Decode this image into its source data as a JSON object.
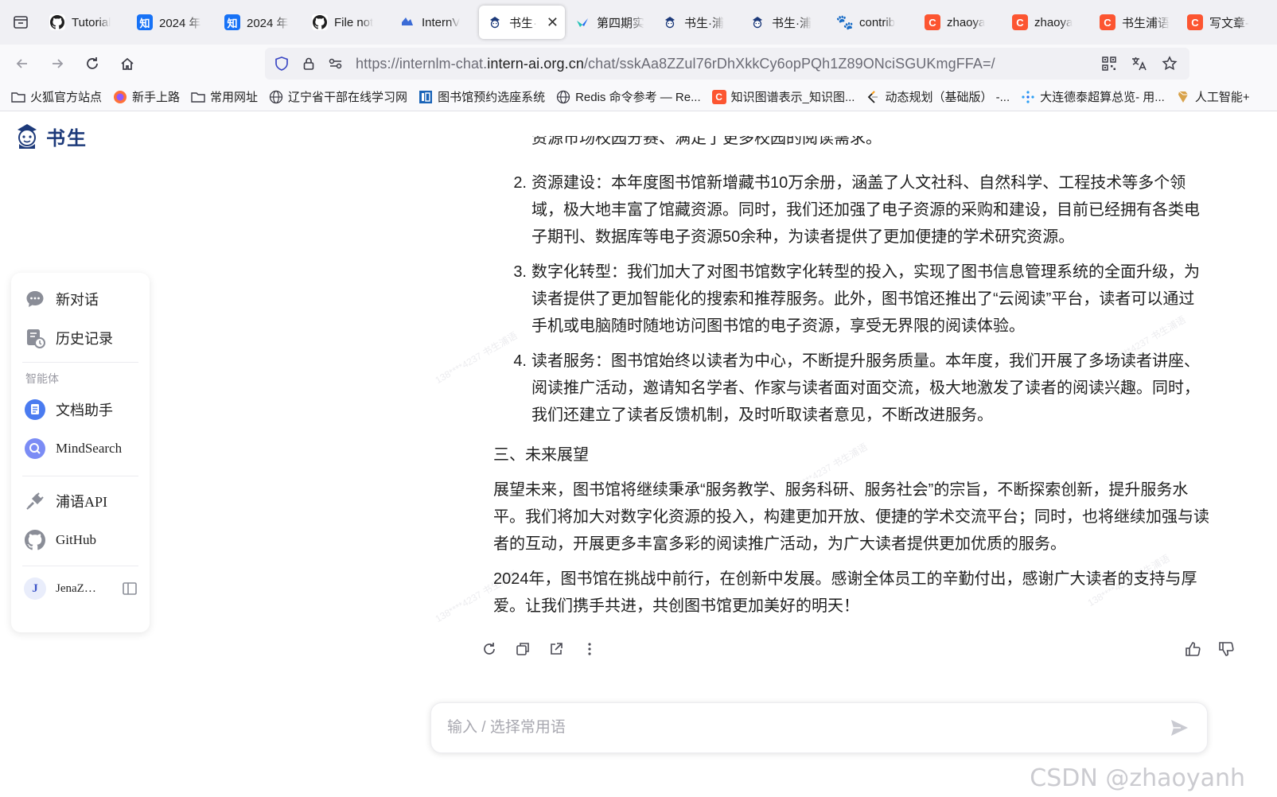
{
  "browser": {
    "tabs": [
      {
        "label": "Tutorial",
        "icon": "github-icon"
      },
      {
        "label": "2024 年",
        "icon": "zhihu-icon"
      },
      {
        "label": "2024 年",
        "icon": "zhihu-icon"
      },
      {
        "label": "File not",
        "icon": "github-icon"
      },
      {
        "label": "InternV",
        "icon": "internvl-icon"
      },
      {
        "label": "书生·",
        "icon": "shusheng-icon",
        "active": true
      },
      {
        "label": "第四期实",
        "icon": "feishu-icon"
      },
      {
        "label": "书生·浦",
        "icon": "shusheng-icon"
      },
      {
        "label": "书生·浦",
        "icon": "shusheng-icon"
      },
      {
        "label": "contrib",
        "icon": "paw-icon"
      },
      {
        "label": "zhaoya",
        "icon": "csdn-icon"
      },
      {
        "label": "zhaoya",
        "icon": "csdn-icon"
      },
      {
        "label": "书生浦语",
        "icon": "csdn-icon"
      },
      {
        "label": "写文章-",
        "icon": "csdn-icon"
      }
    ],
    "close_glyph": "✕",
    "url_prefix": "https://internlm-chat.",
    "url_domain": "intern-ai.org.cn",
    "url_suffix": "/chat/sskAa8ZZul76rDhXkkCy6opPQh1Z89ONciSGUKmgFFA=/",
    "bookmarks": [
      {
        "label": "火狐官方站点",
        "icon": "folder-icon"
      },
      {
        "label": "新手上路",
        "icon": "firefox-icon"
      },
      {
        "label": "常用网址",
        "icon": "folder-icon"
      },
      {
        "label": "辽宁省干部在线学习网",
        "icon": "globe-icon"
      },
      {
        "label": "图书馆预约选座系统",
        "icon": "library-icon"
      },
      {
        "label": "Redis 命令参考 — Re...",
        "icon": "globe-icon"
      },
      {
        "label": "知识图谱表示_知识图...",
        "icon": "csdn-icon"
      },
      {
        "label": "动态规划（基础版） -...",
        "icon": "leetcode-icon"
      },
      {
        "label": "大连德泰超算总览- 用...",
        "icon": "cluster-icon"
      },
      {
        "label": "人工智能+",
        "icon": "ai-icon"
      }
    ]
  },
  "app": {
    "brand": "书生",
    "sidebar": {
      "new_chat": "新对话",
      "history": "历史记录",
      "section_agents": "智能体",
      "doc_assistant": "文档助手",
      "mindsearch": "MindSearch",
      "api": "浦语API",
      "github": "GitHub",
      "user_initial": "J",
      "user_name": "JenaZ…"
    },
    "chat": {
      "cut_line": "资源市场校园分赛、满足了更多校园的阅读需求。",
      "list": [
        {
          "num": "2.",
          "text": "资源建设：本年度图书馆新增藏书10万余册，涵盖了人文社科、自然科学、工程技术等多个领域，极大地丰富了馆藏资源。同时，我们还加强了电子资源的采购和建设，目前已经拥有各类电子期刊、数据库等电子资源50余种，为读者提供了更加便捷的学术研究资源。"
        },
        {
          "num": "3.",
          "text": "数字化转型：我们加大了对图书馆数字化转型的投入，实现了图书信息管理系统的全面升级，为读者提供了更加智能化的搜索和推荐服务。此外，图书馆还推出了“云阅读”平台，读者可以通过手机或电脑随时随地访问图书馆的电子资源，享受无界限的阅读体验。"
        },
        {
          "num": "4.",
          "text": "读者服务：图书馆始终以读者为中心，不断提升服务质量。本年度，我们开展了多场读者讲座、阅读推广活动，邀请知名学者、作家与读者面对面交流，极大地激发了读者的阅读兴趣。同时，我们还建立了读者反馈机制，及时听取读者意见，不断改进服务。"
        }
      ],
      "section3_title": "三、未来展望",
      "para1": "展望未来，图书馆将继续秉承“服务教学、服务科研、服务社会”的宗旨，不断探索创新，提升服务水平。我们将加大对数字化资源的投入，构建更加开放、便捷的学术交流平台；同时，也将继续加强与读者的互动，开展更多丰富多彩的阅读推广活动，为广大读者提供更加优质的服务。",
      "para2": "2024年，图书馆在挑战中前行，在创新中发展。感谢全体员工的辛勤付出，感谢广大读者的支持与厚爱。让我们携手共进，共创图书馆更加美好的明天！"
    },
    "input": {
      "placeholder": "输入 / 选择常用语"
    },
    "watermark": "CSDN @zhaoyanh"
  },
  "colors": {
    "accent": "#3d55c8",
    "brand": "#1d3a7a",
    "csdn": "#fc5531",
    "zhihu": "#1772f6"
  }
}
